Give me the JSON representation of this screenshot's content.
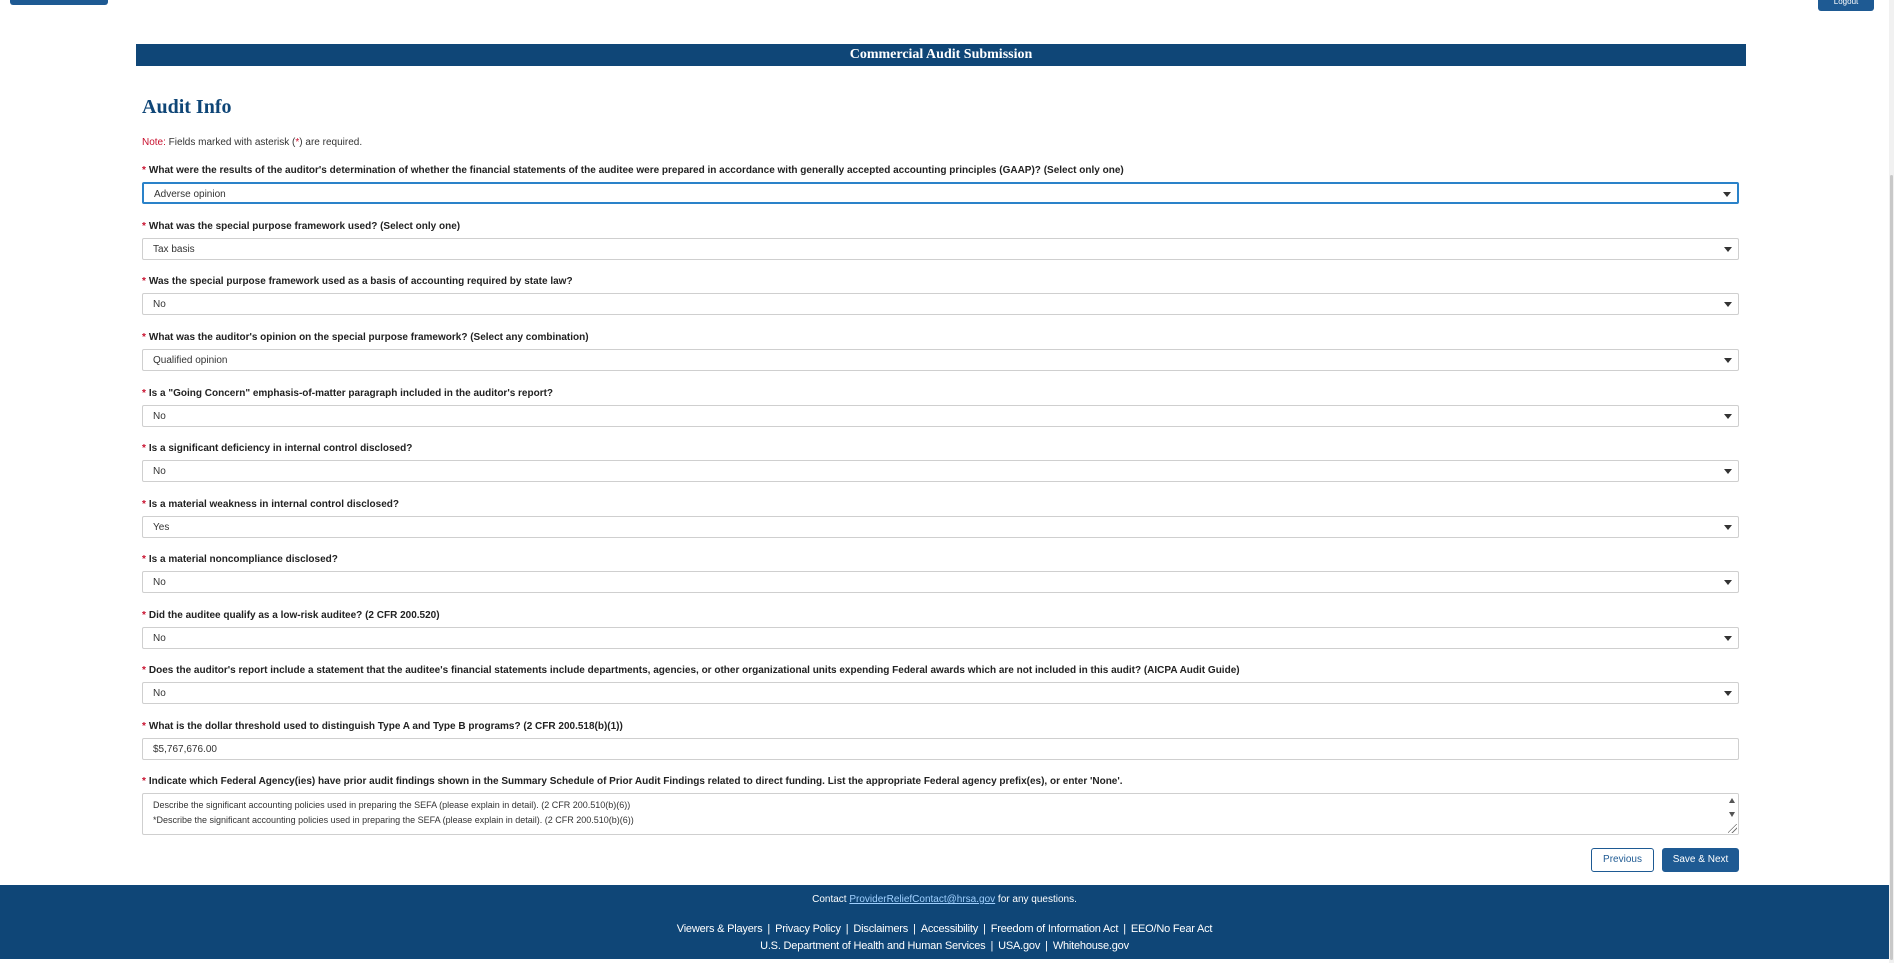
{
  "header": {
    "logout_label": "Logout"
  },
  "banner": {
    "title": "Commercial Audit Submission"
  },
  "section": {
    "title": "Audit Info"
  },
  "note": {
    "label": "Note:",
    "text_before": " Fields marked with asterisk (",
    "asterisk": "*",
    "text_after": ") are required."
  },
  "required_marker": "*",
  "fields": [
    {
      "label": "What were the results of the auditor's determination of whether the financial statements of the auditee were prepared in accordance with generally accepted accounting principles (GAAP)? (Select only one)",
      "value": "Adverse opinion"
    },
    {
      "label": "What was the special purpose framework used? (Select only one)",
      "value": "Tax basis"
    },
    {
      "label": "Was the special purpose framework used as a basis of accounting required by state law?",
      "value": "No"
    },
    {
      "label": "What was the auditor's opinion on the special purpose framework? (Select any combination)",
      "value": "Qualified opinion"
    },
    {
      "label": "Is a \"Going Concern\" emphasis-of-matter paragraph included in the auditor's report?",
      "value": "No"
    },
    {
      "label": "Is a significant deficiency in internal control disclosed?",
      "value": "No"
    },
    {
      "label": "Is a material weakness in internal control disclosed?",
      "value": "Yes"
    },
    {
      "label": "Is a material noncompliance disclosed?",
      "value": "No"
    },
    {
      "label": "Did the auditee qualify as a low-risk auditee? (2 CFR 200.520)",
      "value": "No"
    },
    {
      "label": "Does the auditor's report include a statement that the auditee's financial statements include departments, agencies, or other organizational units expending Federal awards which are not included in this audit? (AICPA Audit Guide)",
      "value": "No"
    },
    {
      "label": "What is the dollar threshold used to distinguish Type A and Type B programs? (2 CFR 200.518(b)(1))",
      "value": "$5,767,676.00"
    },
    {
      "label": "Indicate which Federal Agency(ies) have prior audit findings shown in the Summary Schedule of Prior Audit Findings related to direct funding. List the appropriate Federal agency prefix(es), or enter 'None'.",
      "lines": [
        "Describe the significant accounting policies used in preparing the SEFA (please explain in detail). (2 CFR 200.510(b)(6))",
        "*Describe the significant accounting policies used in preparing the SEFA (please explain in detail). (2 CFR 200.510(b)(6))"
      ]
    }
  ],
  "buttons": {
    "previous": "Previous",
    "save_next": "Save & Next"
  },
  "footer": {
    "contact_prefix": "Contact ",
    "contact_email": "ProviderReliefContact@hrsa.gov",
    "contact_suffix": " for any questions.",
    "links_row1": [
      "Viewers & Players",
      "Privacy Policy",
      "Disclaimers",
      "Accessibility",
      "Freedom of Information Act",
      "EEO/No Fear Act"
    ],
    "links_row2": [
      "U.S. Department of Health and Human Services",
      "USA.gov",
      "Whitehouse.gov"
    ]
  },
  "colors": {
    "banner": "#0f4677",
    "accent": "#1e5a93",
    "required": "#c8102e",
    "focus": "#2a82c9"
  }
}
